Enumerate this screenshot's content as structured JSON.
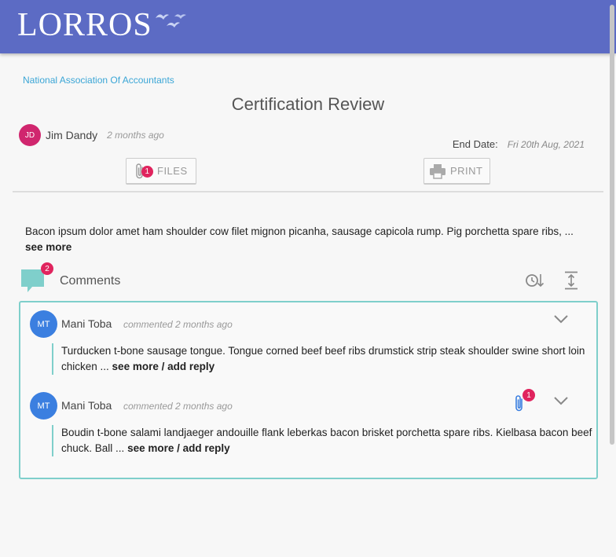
{
  "header": {
    "logo_text": "LORROS"
  },
  "breadcrumb": {
    "organization": "National Association Of Accountants"
  },
  "review": {
    "title": "Certification Review",
    "author": {
      "initials": "JD",
      "name": "Jim Dandy",
      "time": "2 months ago"
    },
    "end_date_label": "End Date:",
    "end_date_value": "Fri 20th Aug, 2021",
    "description": "Bacon ipsum dolor amet ham shoulder cow filet mignon picanha, sausage capicola rump. Pig porchetta spare ribs, ...",
    "see_more": "see more"
  },
  "toolbar": {
    "files_label": "FILES",
    "files_count": "1",
    "print_label": "PRINT"
  },
  "comments": {
    "title": "Comments",
    "count": "2",
    "items": [
      {
        "initials": "MT",
        "author": "Mani Toba",
        "time": "commented 2 months ago",
        "text": "Turducken t-bone sausage tongue. Tongue corned beef beef ribs drumstick strip steak shoulder swine short loin chicken ...",
        "action": "see more / add reply"
      },
      {
        "initials": "MT",
        "author": "Mani Toba",
        "time": "commented 2 months ago",
        "text": "Boudin t-bone salami landjaeger andouille flank leberkas bacon brisket porchetta spare ribs. Kielbasa bacon beef chuck. Ball ...",
        "action": "see more / add reply",
        "attachments": "1"
      }
    ]
  },
  "colors": {
    "header_bg": "#5c6bc4",
    "accent_teal": "#7fcfcb",
    "badge_pink": "#e0245e",
    "avatar_blue": "#3b7fe0",
    "link_blue": "#3ba6d6"
  }
}
